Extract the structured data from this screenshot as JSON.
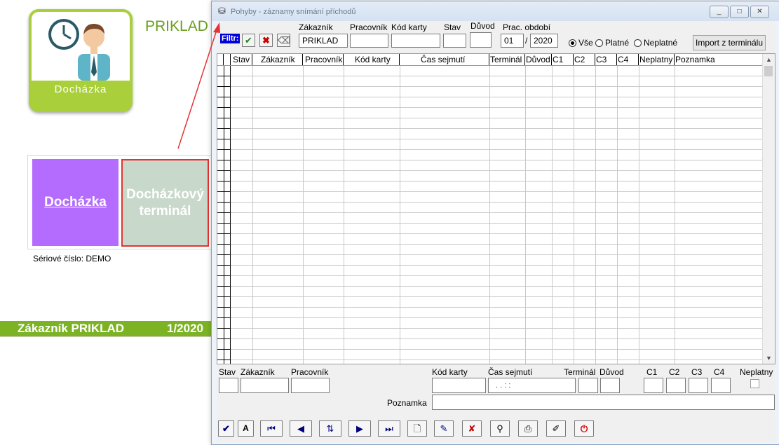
{
  "background_app": {
    "tile_label": "Docházka",
    "title": "PRIKLAD",
    "tile_dochazka": "Docházka",
    "tile_terminal_line1": "Docházkový",
    "tile_terminal_line2": "terminál",
    "serial": "Sériové číslo: DEMO",
    "footer_customer": "Zákazník PRIKLAD",
    "footer_period": "1/2020"
  },
  "window": {
    "title": "Pohyby - záznamy snímání příchodů",
    "controls": {
      "minimize": "▭",
      "maximize": "□",
      "close": "✕"
    }
  },
  "filter": {
    "label": "Filtr:",
    "zakaznik_label": "Zákazník",
    "zakaznik_value": "PRIKLAD",
    "pracovnik_label": "Pracovník",
    "kod_karty_label": "Kód karty",
    "stav_label": "Stav",
    "duvod_label": "Důvod",
    "obdobi_label": "Prac. období",
    "obdobi_month": "01",
    "obdobi_sep": "/",
    "obdobi_year": "2020",
    "radio_all": "Vše",
    "radio_valid": "Platné",
    "radio_invalid": "Neplatné",
    "import_button": "Import z terminálu"
  },
  "grid": {
    "columns": [
      "Stav",
      "Zákazník",
      "Pracovník",
      "Kód karty",
      "Čas sejmutí",
      "Terminál",
      "Důvod",
      "C1",
      "C2",
      "C3",
      "C4",
      "Neplatny",
      "Poznamka"
    ]
  },
  "detail": {
    "stav": "Stav",
    "zakaznik": "Zákazník",
    "pracovnik": "Pracovník",
    "kod_karty": "Kód karty",
    "cas_sejmuti": "Čas sejmutí",
    "cas_mask": ". .       : :",
    "terminal": "Terminál",
    "duvod": "Důvod",
    "c1": "C1",
    "c2": "C2",
    "c3": "C3",
    "c4": "C4",
    "neplatny": "Neplatny",
    "poznamka": "Poznamka"
  },
  "colors": {
    "brand_green": "#7cb325",
    "tile_purple": "#b46cff",
    "tile_gray": "#c8d8ca",
    "filter_blue": "#0000d8",
    "arrow_red": "#e53333"
  }
}
